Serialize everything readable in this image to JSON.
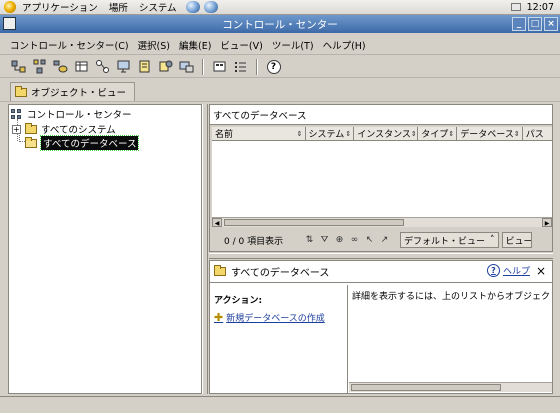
{
  "gnome_panel": {
    "menus": [
      "アプリケーション",
      "場所",
      "システム"
    ],
    "clock": "12:07"
  },
  "window": {
    "title": "コントロール・センター",
    "controls": {
      "minimize": "_",
      "maximize": "□",
      "close": "×"
    }
  },
  "menubar": {
    "items": [
      "コントロール・センター(C)",
      "選択(S)",
      "編集(E)",
      "ビュー(V)",
      "ツール(T)",
      "ヘルプ(H)"
    ]
  },
  "toolbar": {
    "icons": [
      "system-icon",
      "instance-icon",
      "database-icon",
      "table-icon",
      "replication-icon",
      "monitor-icon",
      "journal-icon",
      "task-icon",
      "network-icon",
      "details-icon",
      "list-icon",
      "help-icon"
    ],
    "help_glyph": "?"
  },
  "object_view": {
    "tab_label": "オブジェクト・ビュー"
  },
  "tree": {
    "root": "コントロール・センター",
    "children": [
      {
        "label": "すべてのシステム",
        "expander": "+"
      },
      {
        "label": "すべてのデータベース",
        "selected": true
      }
    ]
  },
  "list_panel": {
    "caption": "すべてのデータベース",
    "columns": [
      "名前",
      "システム",
      "インスタンス",
      "タイプ",
      "データベース",
      "パス"
    ],
    "rows": [],
    "item_count": "0 / 0 項目表示",
    "filter_buttons": [
      "sort-icon",
      "filter-icon",
      "find-icon",
      "binoculars-icon",
      "select-icon",
      "clear-icon"
    ],
    "view_dropdown": "デフォルト・ビュー",
    "view_button": "ビュー"
  },
  "details_panel": {
    "title": "すべてのデータベース",
    "help_label": "ヘルプ",
    "close_glyph": "×",
    "actions_title": "アクション:",
    "actions": [
      "新規データベースの作成"
    ],
    "detail_text": "詳細を表示するには、上のリストからオブジェクトを選"
  }
}
